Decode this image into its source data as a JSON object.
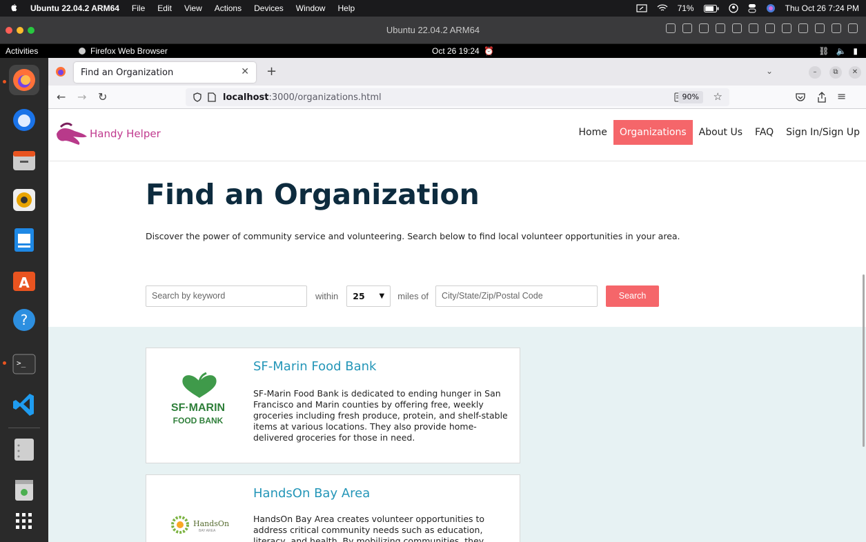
{
  "mac_menubar": {
    "app_name": "Ubuntu 22.04.2 ARM64",
    "menus": [
      "File",
      "Edit",
      "View",
      "Actions",
      "Devices",
      "Window",
      "Help"
    ],
    "battery": "71%",
    "datetime": "Thu Oct 26  7:24 PM"
  },
  "vm_window": {
    "title": "Ubuntu 22.04.2 ARM64"
  },
  "gnome": {
    "activities": "Activities",
    "app_name": "Firefox Web Browser",
    "clock": "Oct 26  19:24"
  },
  "browser": {
    "tab_title": "Find an Organization",
    "url_host": "localhost",
    "url_rest": ":3000/organizations.html",
    "zoom": "90%"
  },
  "site": {
    "logo_text": "Handy Helper",
    "nav": {
      "home": "Home",
      "organizations": "Organizations",
      "about": "About Us",
      "faq": "FAQ",
      "signin": "Sign In/Sign Up"
    },
    "active_color": "#f5666a",
    "title": "Find an Organization",
    "description": "Discover the power of community service and volunteering. Search below to find local volunteer opportunities in your area.",
    "search": {
      "keyword_placeholder": "Search by keyword",
      "within_label": "within",
      "miles_value": "25",
      "miles_label": "miles of",
      "location_placeholder": "City/State/Zip/Postal Code",
      "button": "Search"
    },
    "results": [
      {
        "name": "SF-Marin Food Bank",
        "logo_line1": "SF·MARIN",
        "logo_line2": "FOOD BANK",
        "description": "SF-Marin Food Bank is dedicated to ending hunger in San Francisco and Marin counties by offering free, weekly groceries including fresh produce, protein, and shelf-stable items at various locations. They also provide home-delivered groceries for those in need."
      },
      {
        "name": "HandsOn Bay Area",
        "logo_line1": "HandsOn",
        "logo_line2": "BAY AREA",
        "description": "HandsOn Bay Area creates volunteer opportunities to address critical community needs such as education, literacy, and health. By mobilizing communities, they"
      }
    ]
  }
}
